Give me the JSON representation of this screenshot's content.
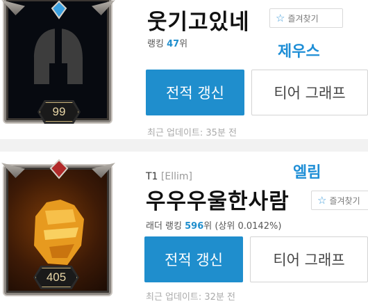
{
  "cards": [
    {
      "summoner_name": "웃기고있네",
      "favorite_label": "즐겨찾기",
      "rank_prefix": "랭킹",
      "rank_value": "47",
      "rank_suffix": "위",
      "annotation": "제우스",
      "level": "99",
      "refresh_button": "전적 갱신",
      "tier_graph_button": "티어 그래프",
      "last_updated": "최근 업데이트: 35분 전",
      "avatar_icon": "spartan-helmet-icon"
    },
    {
      "team": "T1",
      "team_player": "[Ellim]",
      "summoner_name": "우우우울한사람",
      "favorite_label": "즐겨찾기",
      "rank_prefix": "래더 랭킹",
      "rank_value": "596",
      "rank_suffix": "위 (상위 0.0142%)",
      "annotation": "엘림",
      "level": "405",
      "refresh_button": "전적 갱신",
      "tier_graph_button": "티어 그래프",
      "last_updated": "최근 업데이트: 32분 전",
      "avatar_icon": "golden-fist-icon"
    }
  ],
  "colors": {
    "accent": "#1f8ecd",
    "annotation": "#1e8ed6"
  }
}
